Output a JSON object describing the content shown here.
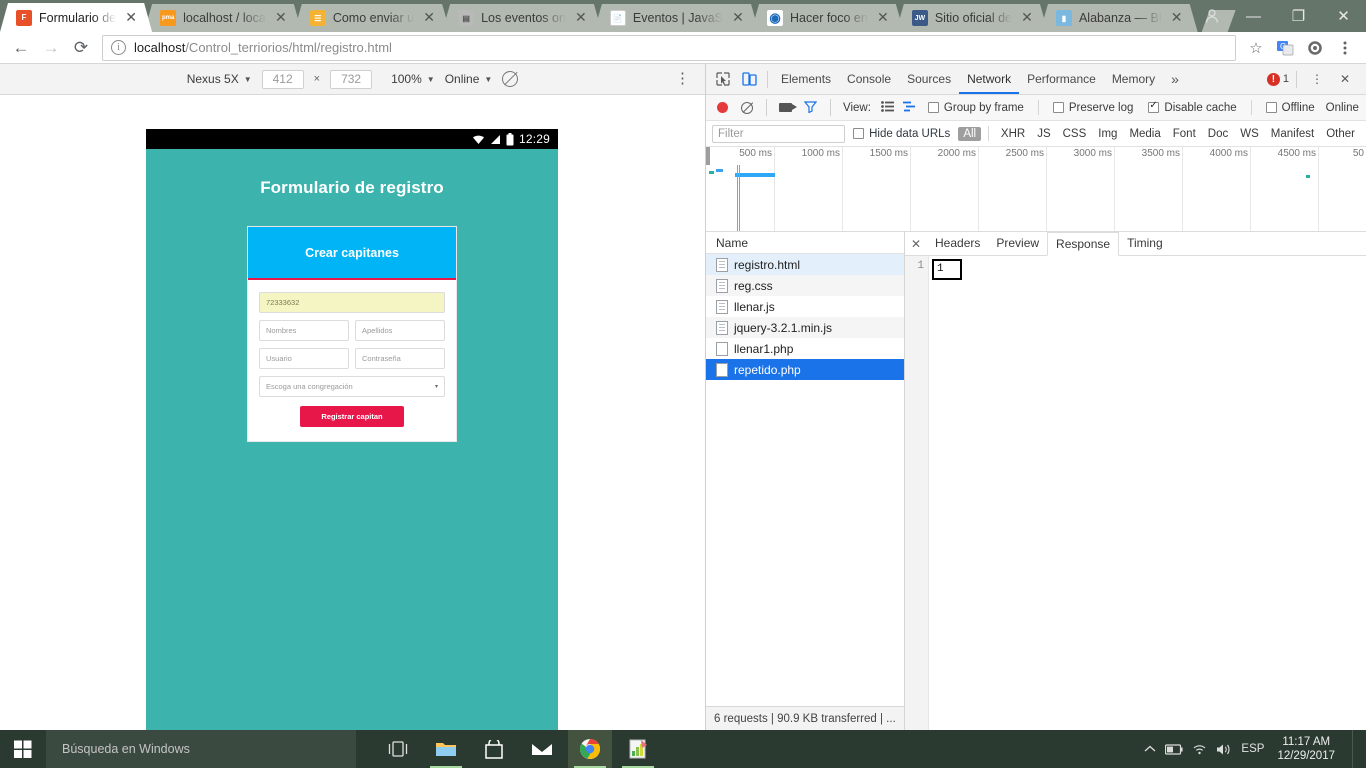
{
  "browser": {
    "tabs": [
      {
        "title": "Formulario de ",
        "favicon": "form-icon",
        "favicon_color": "#e8502a",
        "favicon_text": "F",
        "active": true
      },
      {
        "title": "localhost / loca",
        "favicon": "phpmyadmin-icon",
        "favicon_color": "#f8981d",
        "favicon_text": "pma",
        "active": false
      },
      {
        "title": "Como enviar u",
        "favicon": "stackoverflow-icon",
        "favicon_color": "#f5b335",
        "favicon_text": "S",
        "active": false
      },
      {
        "title": "Los eventos on",
        "favicon": "article-icon",
        "favicon_color": "#b0b0b0",
        "favicon_text": "☰",
        "active": false
      },
      {
        "title": "Eventos | JavaS",
        "favicon": "page-icon",
        "favicon_color": "#ffffff",
        "favicon_text": "—",
        "active": false
      },
      {
        "title": "Hacer foco en ",
        "favicon": "circle-icon",
        "favicon_color": "#1c6bba",
        "favicon_text": "◉",
        "active": false
      },
      {
        "title": "Sitio oficial de",
        "favicon": "jw-icon",
        "favicon_color": "#3b5a87",
        "favicon_text": "JW",
        "active": false
      },
      {
        "title": "Alabanza — Bl",
        "favicon": "book-icon",
        "favicon_color": "#7ab8e0",
        "favicon_text": "▮",
        "active": false
      }
    ],
    "new_tab_label": "New tab",
    "window_controls": {
      "minimize": "—",
      "maximize": "❐",
      "close": "✕"
    },
    "nav": {
      "back": "←",
      "forward": "→",
      "reload": "⟳"
    },
    "omnibox": {
      "host": "localhost",
      "path": "/Control_terriorios/html/registro.html",
      "info_icon": "ⓘ",
      "star": "☆"
    },
    "toolbar_icons": [
      "translate-icon",
      "extension-gear-icon",
      "chrome-menu-icon"
    ]
  },
  "device_bar": {
    "device": "Nexus 5X",
    "width": "412",
    "height": "732",
    "times": "×",
    "zoom": "100%",
    "network": "Online",
    "rotate": "rotate-icon",
    "kebab": "⋮"
  },
  "mobile_page": {
    "status_bar": {
      "time": "12:29",
      "icons": [
        "wifi-icon",
        "signal-icon",
        "battery-icon"
      ]
    },
    "title": "Formulario de registro",
    "card_header": "Crear capitanes",
    "fields": {
      "code_value": "72333632",
      "nombres_placeholder": "Nombres",
      "apellidos_placeholder": "Apellidos",
      "usuario_placeholder": "Usuario",
      "contrasena_placeholder": "Contraseña",
      "congregacion_placeholder": "Escoga una congregación",
      "select_arrow": "▾"
    },
    "submit_label": "Registrar capitan",
    "colors": {
      "background": "#3cb3ad",
      "card_header": "#00b4f5",
      "accent": "#e8174a",
      "filled_field": "#f5f5c3"
    }
  },
  "devtools": {
    "tabs": [
      {
        "label": "Elements",
        "active": false
      },
      {
        "label": "Console",
        "active": false
      },
      {
        "label": "Sources",
        "active": false
      },
      {
        "label": "Network",
        "active": true
      },
      {
        "label": "Performance",
        "active": false
      },
      {
        "label": "Memory",
        "active": false
      }
    ],
    "more_tabs": "»",
    "error_count": "1",
    "kebab": "⋮",
    "close": "✕",
    "inspect_icon": "inspect-element-icon",
    "device_toggle_icon": "toggle-device-toolbar-icon",
    "toolbar": {
      "record": "record-button",
      "clear": "clear-button",
      "capture_screenshots": "camera-button",
      "filter_toggle": "funnel-button",
      "view_label": "View:",
      "group_by_frame": "Group by frame",
      "group_by_frame_checked": false,
      "preserve_log": "Preserve log",
      "preserve_log_checked": false,
      "disable_cache": "Disable cache",
      "disable_cache_checked": true,
      "offline": "Offline",
      "offline_checked": false,
      "online": "Online"
    },
    "filter_bar": {
      "placeholder": "Filter",
      "value": "",
      "hide_data_urls": "Hide data URLs",
      "hide_data_urls_checked": false,
      "types": [
        "All",
        "XHR",
        "JS",
        "CSS",
        "Img",
        "Media",
        "Font",
        "Doc",
        "WS",
        "Manifest",
        "Other"
      ],
      "active_type": "All"
    },
    "timeline": {
      "ticks": [
        "500 ms",
        "1000 ms",
        "1500 ms",
        "2000 ms",
        "2500 ms",
        "3000 ms",
        "3500 ms",
        "4000 ms",
        "4500 ms",
        "50"
      ]
    },
    "request_list": {
      "header": "Name",
      "rows": [
        {
          "name": "registro.html",
          "icon": "document-icon",
          "state": "highlight"
        },
        {
          "name": "reg.css",
          "icon": "document-icon",
          "state": "normal"
        },
        {
          "name": "llenar.js",
          "icon": "document-icon",
          "state": "normal"
        },
        {
          "name": "jquery-3.2.1.min.js",
          "icon": "document-icon",
          "state": "normal"
        },
        {
          "name": "llenar1.php",
          "icon": "blank-document-icon",
          "state": "normal"
        },
        {
          "name": "repetido.php",
          "icon": "blank-document-icon",
          "state": "selected"
        }
      ],
      "status": "6 requests  |  90.9 KB transferred  |  ..."
    },
    "detail": {
      "close": "✕",
      "tabs": [
        {
          "label": "Headers",
          "active": false
        },
        {
          "label": "Preview",
          "active": false
        },
        {
          "label": "Response",
          "active": true
        },
        {
          "label": "Timing",
          "active": false
        }
      ],
      "line_number": "1",
      "response_text": "1"
    }
  },
  "taskbar": {
    "start": "windows-start-icon",
    "search_placeholder": "Búsqueda en Windows",
    "task_view": "task-view-icon",
    "apps": [
      {
        "name": "file-explorer-icon",
        "glyph": "🗀",
        "running": true,
        "active": false
      },
      {
        "name": "microsoft-store-icon",
        "glyph": "🛍",
        "running": false,
        "active": false
      },
      {
        "name": "mail-icon",
        "glyph": "✉",
        "running": false,
        "active": false
      },
      {
        "name": "chrome-icon",
        "glyph": "◉",
        "running": true,
        "active": true
      },
      {
        "name": "notepad-icon",
        "glyph": "📝",
        "running": true,
        "active": false
      }
    ],
    "tray": {
      "chevron": "⌃",
      "battery": "battery-icon",
      "wifi": "wifi-icon",
      "volume": "volume-icon",
      "language": "ESP",
      "time": "11:17 AM",
      "date": "12/29/2017"
    }
  }
}
